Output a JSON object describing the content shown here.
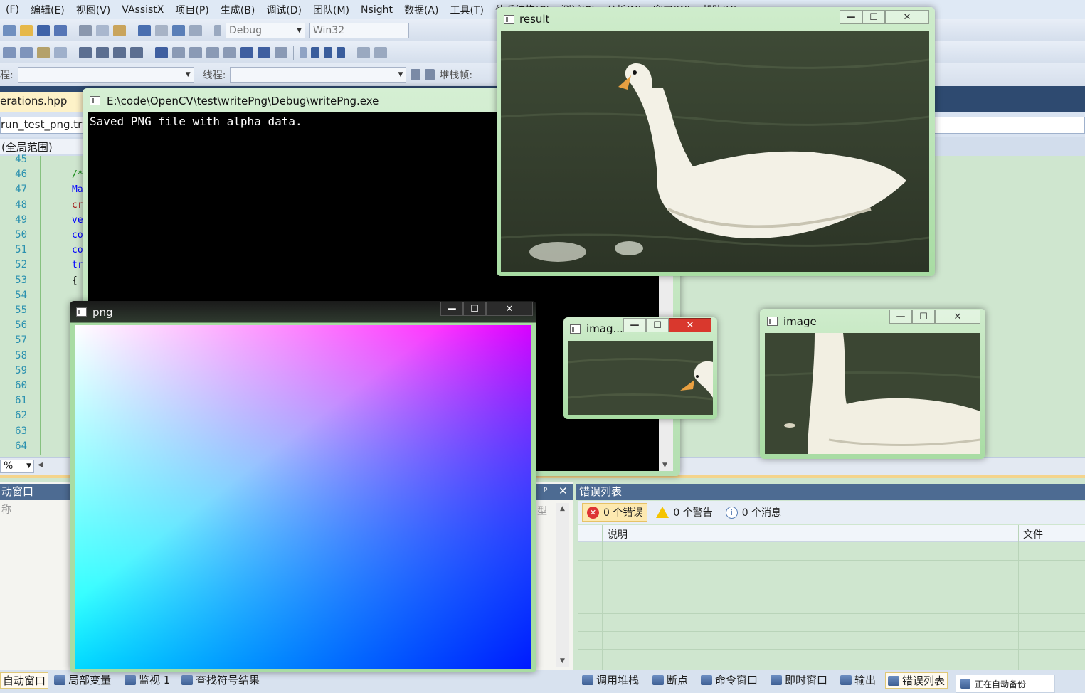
{
  "menubar": {
    "items": [
      "(F)",
      "编辑(E)",
      "视图(V)",
      "VAssistX",
      "项目(P)",
      "生成(B)",
      "调试(D)",
      "团队(M)",
      "Nsight",
      "数据(A)",
      "工具(T)",
      "体系结构(C)",
      "测试(S)",
      "分析(N)",
      "窗口(W)",
      "帮助(H)"
    ]
  },
  "toolbar": {
    "config_value": "Debug",
    "platform_value": "Win32",
    "process_label": "程:",
    "thread_label": "线程:",
    "stackframe_label": "堆栈帧:"
  },
  "editor": {
    "active_tab": "erations.hpp",
    "nav_left": "run_test_png.try",
    "scope": "(全局范围)",
    "line_numbers": [
      "45",
      "46",
      "47",
      "48",
      "49",
      "50",
      "51",
      "52",
      "53",
      "54",
      "55",
      "56",
      "57",
      "58",
      "59",
      "60",
      "61",
      "62",
      "63",
      "64"
    ],
    "code_fragments": [
      {
        "line": "46",
        "text": "/*",
        "color": "#008000"
      },
      {
        "line": "47",
        "text": "Ma",
        "color": "#0000ff"
      },
      {
        "line": "48",
        "text": "cr",
        "color": "#a31515"
      },
      {
        "line": "49",
        "text": "ve",
        "color": "#0000ff"
      },
      {
        "line": "50",
        "text": "co",
        "color": "#0000ff"
      },
      {
        "line": "51",
        "text": "co",
        "color": "#0000ff"
      },
      {
        "line": "52",
        "text": "tr",
        "color": "#0000ff"
      },
      {
        "line": "53",
        "text": "{",
        "color": "#000000"
      }
    ],
    "zoom": "%"
  },
  "bottom_left_panel": {
    "title": "动窗口",
    "column_name": "称",
    "column_type": "型"
  },
  "error_list": {
    "title": "错误列表",
    "errors_label": "0 个错误",
    "warnings_label": "0 个警告",
    "messages_label": "0 个消息",
    "col_description": "说明",
    "col_file": "文件"
  },
  "statusbar": {
    "left_items": [
      "自动窗口",
      "局部变量",
      "监视 1",
      "查找符号结果"
    ],
    "right_items": [
      "调用堆栈",
      "断点",
      "命令窗口",
      "即时窗口",
      "输出",
      "错误列表"
    ],
    "backup_text": "正在自动备份"
  },
  "windows": {
    "console": {
      "title": "E:\\code\\OpenCV\\test\\writePng\\Debug\\writePng.exe",
      "output": "Saved PNG file with alpha data."
    },
    "result": {
      "title": "result"
    },
    "png": {
      "title": "png"
    },
    "image_small": {
      "title": "imag..."
    },
    "image": {
      "title": "image"
    }
  },
  "colors": {
    "editor_bg": "#cfe6cf",
    "panel_title_bg": "#4d6b92",
    "tab_bar_bg": "#2e4a70",
    "console_bg": "#000000",
    "close_button_red": "#d9382d"
  }
}
